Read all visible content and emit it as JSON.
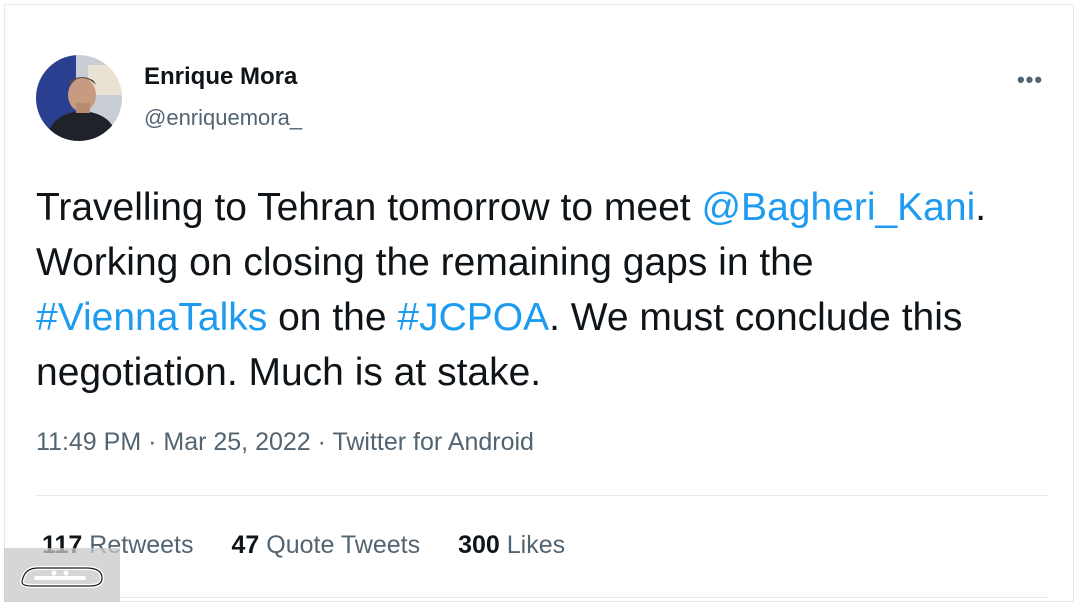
{
  "user": {
    "name": "Enrique Mora",
    "handle": "@enriquemora_"
  },
  "more_icon": "ellipsis-icon",
  "tweet": {
    "line1_prefix": "Travelling to Tehran tomorrow to meet ",
    "mention": "@Bagheri_Kani",
    "line1_suffix": ".",
    "line2": "Working on closing the remaining gaps in the",
    "hashtag1": "#ViennaTalks",
    "mid": " on the ",
    "hashtag2": "#JCPOA",
    "line3_suffix": ". We must conclude this",
    "line4": "negotiation. Much is at stake."
  },
  "meta": {
    "time": "11:49 PM",
    "sep1": " · ",
    "date": "Mar 25, 2022",
    "sep2": " · ",
    "source": "Twitter for Android"
  },
  "stats": {
    "retweets_count": "117",
    "retweets_label": " Retweets",
    "quotes_count": "47",
    "quotes_label": " Quote Tweets",
    "likes_count": "300",
    "likes_label": " Likes"
  },
  "colors": {
    "link": "#1d9bf0",
    "text": "#0f1419",
    "secondary": "#536471"
  }
}
